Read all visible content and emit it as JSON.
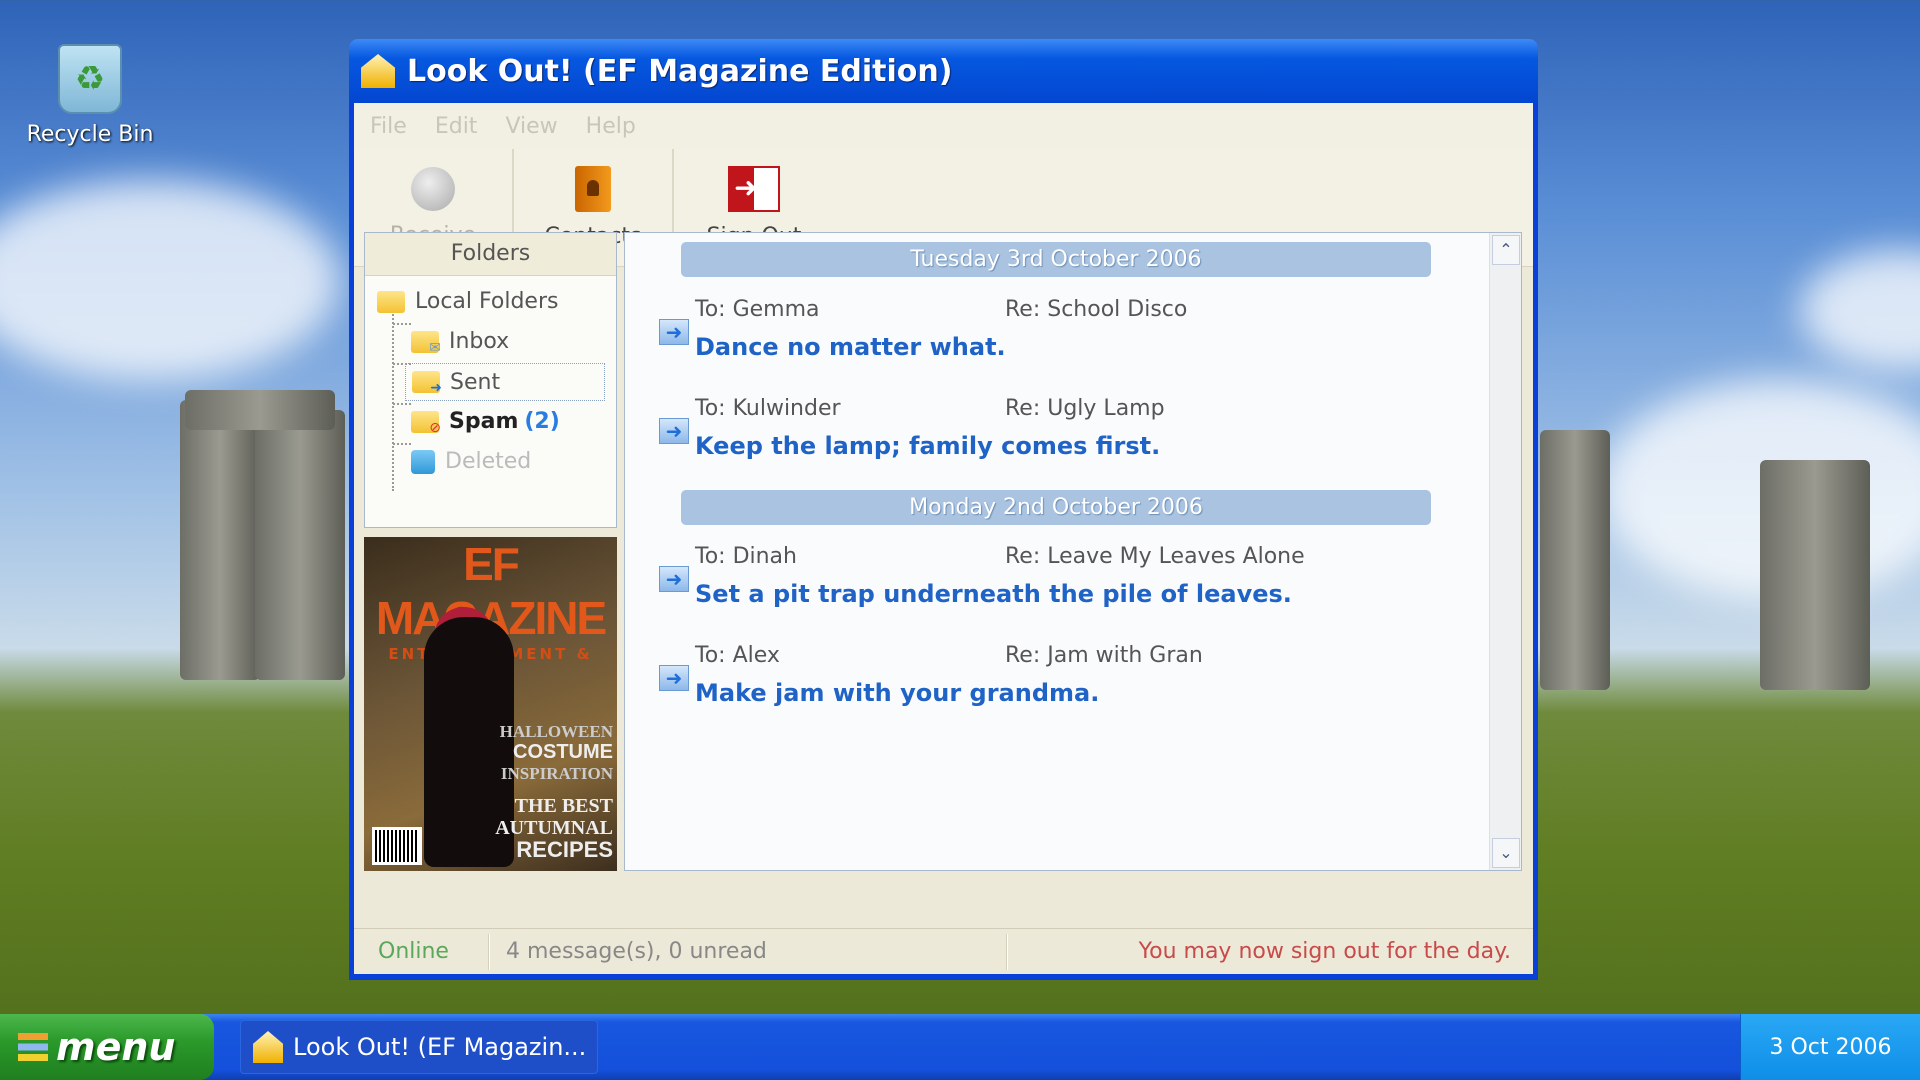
{
  "desktop": {
    "icons": [
      {
        "label": "Recycle Bin",
        "icon": "recycle-bin-icon"
      }
    ]
  },
  "window": {
    "title": "Look Out! (EF Magazine Edition)"
  },
  "menu": [
    "File",
    "Edit",
    "View",
    "Help"
  ],
  "toolbar": {
    "receive": "Receive",
    "contacts": "Contacts",
    "sign_out": "Sign Out"
  },
  "folders": {
    "header": "Folders",
    "root": "Local Folders",
    "inbox": "Inbox",
    "sent": "Sent",
    "spam": "Spam",
    "spam_count": "(2)",
    "deleted": "Deleted",
    "selected": "Sent"
  },
  "magazine": {
    "title": "EF MAGAZINE",
    "tagline": "ENTERTAINMENT & FUN",
    "headline1": "HALLOWEEN",
    "headline2": "COSTUME",
    "headline3": "INSPIRATION",
    "headline4": "THE BEST",
    "headline5": "AUTUMNAL",
    "headline6": "RECIPES"
  },
  "messages": {
    "groups": [
      {
        "date": "Tuesday 3rd October 2006",
        "items": [
          {
            "to": "To: Gemma",
            "re": "Re: School Disco",
            "body": "Dance no matter what."
          },
          {
            "to": "To: Kulwinder",
            "re": "Re: Ugly Lamp",
            "body": "Keep the lamp; family comes first."
          }
        ]
      },
      {
        "date": "Monday 2nd October 2006",
        "items": [
          {
            "to": "To: Dinah",
            "re": "Re: Leave My Leaves Alone",
            "body": "Set a pit trap underneath the pile of leaves."
          },
          {
            "to": "To: Alex",
            "re": "Re: Jam with Gran",
            "body": "Make jam with your grandma."
          }
        ]
      }
    ]
  },
  "status": {
    "connection": "Online",
    "summary": "4 message(s), 0 unread",
    "notice": "You may now sign out for the day.",
    "online_color": "#5aa85a",
    "notice_color": "#c84a4a"
  },
  "taskbar": {
    "start_label": "menu",
    "task_label": "Look Out! (EF Magazin...",
    "clock": "3 Oct 2006"
  }
}
